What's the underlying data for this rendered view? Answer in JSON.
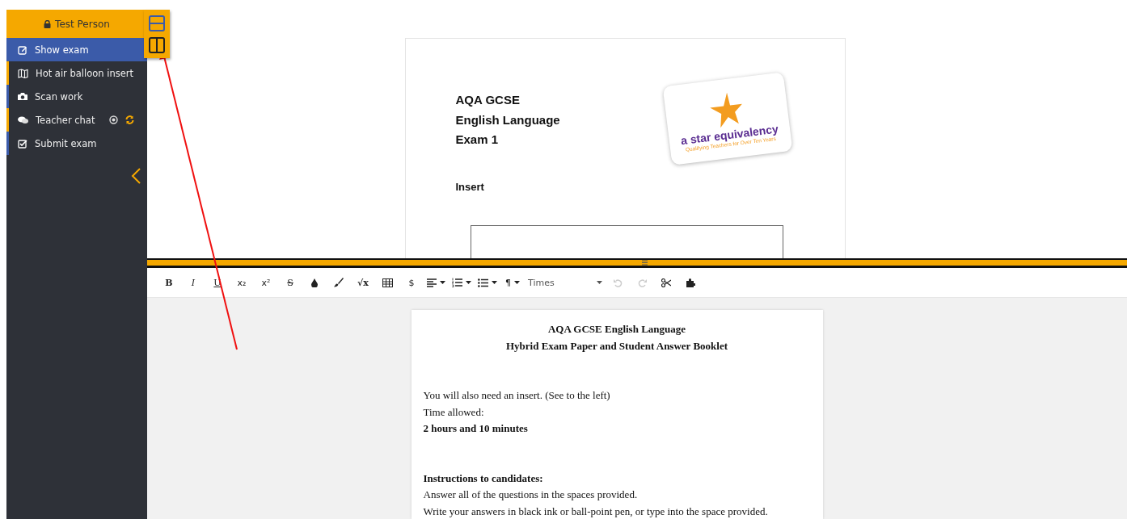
{
  "user": {
    "name": "Test Person"
  },
  "sidebar": {
    "items": [
      {
        "label": "Show exam",
        "selected": true,
        "color": "#3b5ba9",
        "kind": "edit"
      },
      {
        "label": "Hot air balloon insert",
        "selected": false,
        "color": "#f5a800",
        "kind": "map"
      },
      {
        "label": "Scan work",
        "selected": false,
        "color": "#3b5ba9",
        "kind": "camera"
      },
      {
        "label": "Teacher chat",
        "selected": false,
        "color": "#f5a800",
        "kind": "chat"
      },
      {
        "label": "Submit exam",
        "selected": false,
        "color": "#3b5ba9",
        "kind": "check"
      }
    ]
  },
  "layout_options": [
    {
      "kind": "horizontal",
      "selected": false
    },
    {
      "kind": "vertical",
      "selected": true
    }
  ],
  "insert_page": {
    "lines": [
      "AQA GCSE",
      "English Language",
      "Exam 1"
    ],
    "heading": "Insert",
    "logo": {
      "name": "a star equivalency",
      "tagline": "Qualifying Teachers for Over Ten Years"
    }
  },
  "toolbar": [
    {
      "kind": "bold",
      "label": "B",
      "disabled": false
    },
    {
      "kind": "italic",
      "label": "I",
      "disabled": false
    },
    {
      "kind": "underline",
      "label": "U",
      "disabled": false
    },
    {
      "kind": "text",
      "label": "x₂",
      "disabled": false
    },
    {
      "kind": "text",
      "label": "x²",
      "disabled": false
    },
    {
      "kind": "strike",
      "label": "S",
      "disabled": false
    },
    {
      "kind": "drop",
      "disabled": false
    },
    {
      "kind": "brush",
      "disabled": false
    },
    {
      "kind": "bold",
      "label": "√x",
      "disabled": false
    },
    {
      "kind": "table",
      "disabled": false
    },
    {
      "kind": "text",
      "label": "$",
      "disabled": false
    },
    {
      "kind": "align",
      "dropdown": true,
      "disabled": false
    },
    {
      "kind": "olist",
      "dropdown": true,
      "disabled": false
    },
    {
      "kind": "ulist",
      "dropdown": true,
      "disabled": false
    },
    {
      "kind": "text",
      "label": "¶",
      "dropdown": true,
      "disabled": false
    },
    {
      "kind": "font",
      "label": "Times",
      "dropdown": true,
      "disabled": false
    },
    {
      "kind": "undo",
      "disabled": true
    },
    {
      "kind": "redo",
      "disabled": true
    },
    {
      "kind": "scissors",
      "disabled": false
    },
    {
      "kind": "puzzle",
      "disabled": false
    }
  ],
  "document": {
    "lines": [
      {
        "kind": "heading",
        "text": "AQA GCSE English Language",
        "gap_before": false
      },
      {
        "kind": "heading",
        "text": "Hybrid Exam Paper and Student Answer Booklet",
        "gap_before": false
      },
      {
        "kind": "plain",
        "text": "You will also need an insert. (See to the left)",
        "gap_before": true
      },
      {
        "kind": "plain",
        "text": "Time allowed:",
        "gap_before": false
      },
      {
        "kind": "bold",
        "text": "2 hours and 10 minutes",
        "gap_before": false
      },
      {
        "kind": "bold",
        "text": "Instructions to candidates:",
        "gap_before": true
      },
      {
        "kind": "plain",
        "text": "Answer all of the questions in the spaces provided.",
        "gap_before": false
      },
      {
        "kind": "plain",
        "text": "Write your answers in black ink or ball-point pen, or type into the space provided.",
        "gap_before": false
      }
    ]
  }
}
